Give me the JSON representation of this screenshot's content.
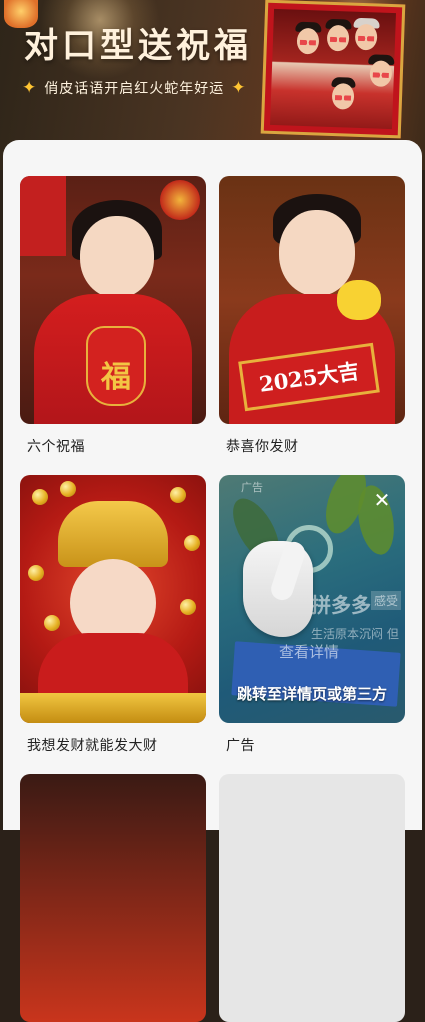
{
  "banner": {
    "title": "对口型送祝福",
    "subtitle": "俏皮话语开启红火蛇年好运"
  },
  "cards": [
    {
      "label": "六个祝福",
      "image": "girl-holding-fu-bag"
    },
    {
      "label": "恭喜你发财",
      "image": "boy-holding-2025-sign",
      "sign_text": "2025大吉"
    },
    {
      "label": "我想发财就能发大财",
      "image": "baby-with-crown-and-coins"
    },
    {
      "label": "广告",
      "ad": {
        "tag": "广告",
        "brand": "拼多多",
        "badge": "感受",
        "sub": "生活原本沉闷 但",
        "button": "查看详情",
        "cta": "跳转至详情页或第三方"
      }
    }
  ],
  "icons": {
    "sparkle": "✦",
    "close": "✕"
  }
}
